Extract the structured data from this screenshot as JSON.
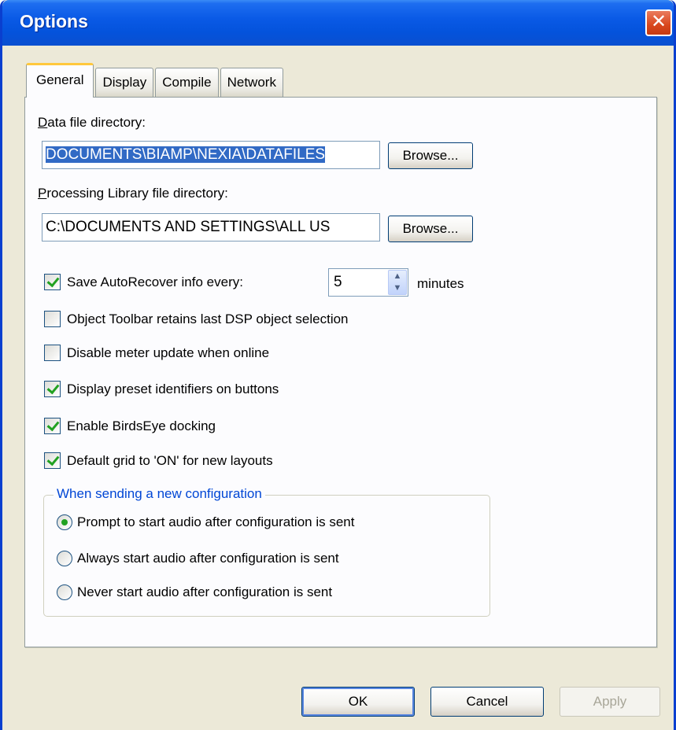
{
  "window": {
    "title": "Options",
    "close_label": "✕"
  },
  "tabs": [
    {
      "label": "General",
      "active": true
    },
    {
      "label": "Display",
      "active": false
    },
    {
      "label": "Compile",
      "active": false
    },
    {
      "label": "Network",
      "active": false
    }
  ],
  "general": {
    "data_dir": {
      "label_ul": "D",
      "label_rest": "ata file directory:",
      "value": "DOCUMENTS\\BIAMP\\NEXIA\\DATAFILES",
      "browse_label": "Browse..."
    },
    "lib_dir": {
      "label_ul": "P",
      "label_rest": "rocessing Library file directory:",
      "value": "C:\\DOCUMENTS AND SETTINGS\\ALL US",
      "browse_label": "Browse..."
    },
    "autorecover": {
      "label": "Save AutoRecover info every:",
      "checked": true,
      "value": "5",
      "unit": "minutes"
    },
    "options": [
      {
        "label": "Object Toolbar retains last DSP object selection",
        "checked": false
      },
      {
        "label": "Disable meter update when online",
        "checked": false
      },
      {
        "label": "Display preset identifiers on buttons",
        "checked": true
      },
      {
        "label": "Enable BirdsEye docking",
        "checked": true
      },
      {
        "label": "Default grid to 'ON' for new layouts",
        "checked": true
      }
    ],
    "send_group": {
      "title": "When sending a new configuration",
      "radios": [
        {
          "label": "Prompt to start audio after configuration is sent",
          "selected": true
        },
        {
          "label": "Always start audio after configuration is sent",
          "selected": false
        },
        {
          "label": "Never start audio after configuration is sent",
          "selected": false
        }
      ]
    }
  },
  "footer": {
    "ok_label": "OK",
    "cancel_label": "Cancel",
    "apply_label": "Apply"
  },
  "colors": {
    "titlebar": "#0a5ae6",
    "dialog_bg": "#ece9d8",
    "group_title": "#0046d5",
    "check_mark": "#21a121"
  }
}
